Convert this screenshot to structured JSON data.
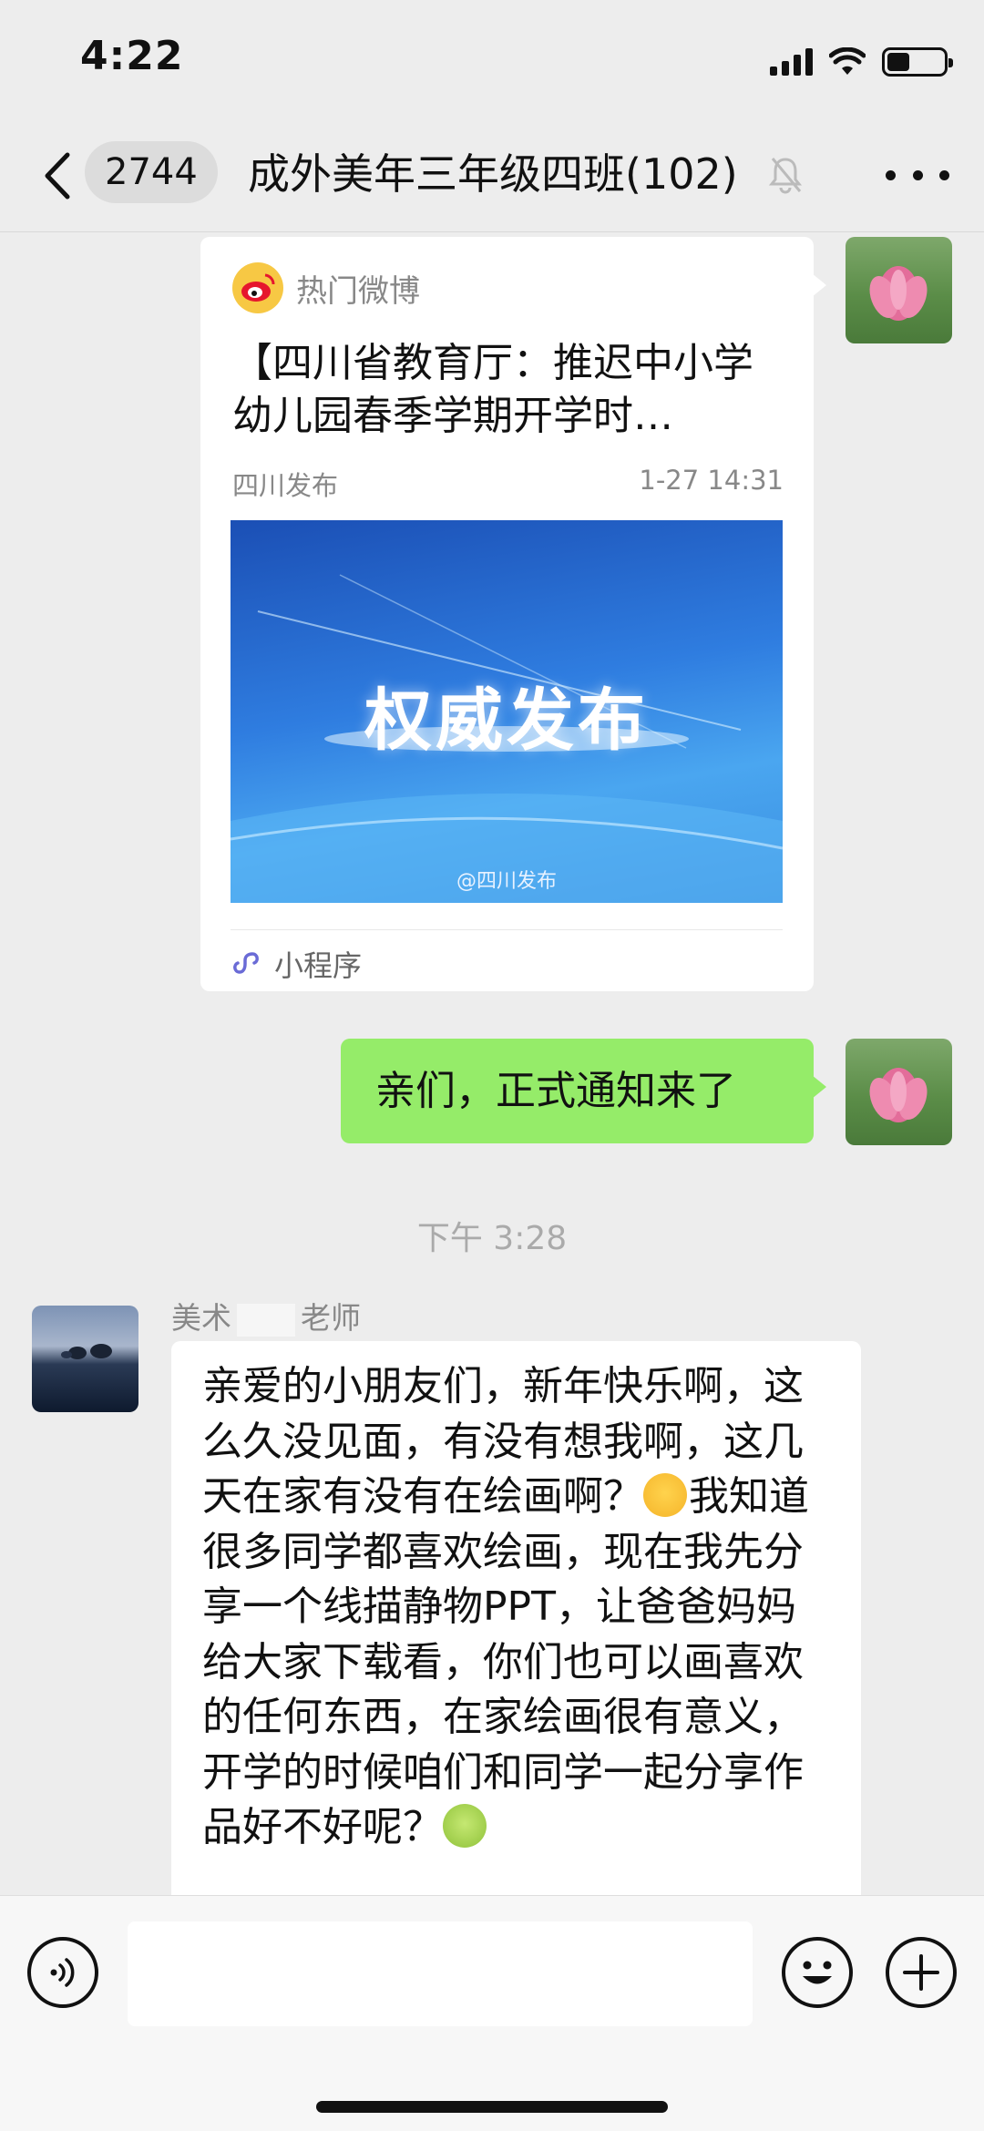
{
  "status_bar": {
    "time": "4:22"
  },
  "nav": {
    "unread_count": "2744",
    "title": "成外美年三年级四班(102)"
  },
  "card": {
    "source": "热门微博",
    "title": "【四川省教育厅：推迟中小学幼儿园春季学期开学时…",
    "publisher": "四川发布",
    "date": "1-27 14:31",
    "image_text": "权威发布",
    "image_watermark": "@四川发布",
    "footer_label": "小程序"
  },
  "messages": {
    "me_text": "亲们，正式通知来了",
    "time_label": "下午 3:28",
    "sender_prefix": "美术",
    "sender_suffix": "老师",
    "body_part1": "亲爱的小朋友们，新年快乐啊，这么久没见面，有没有想我啊，这几天在家有没有在绘画啊？",
    "body_part2": "我知道很多同学都喜欢绘画，现在我先分享一个线描静物PPT，让爸爸妈妈给大家下载看，你们也可以画喜欢的任何东西，在家绘画很有意义，开学的时候咱们和同学一起分享作品好不好呢？"
  },
  "input": {
    "value": ""
  },
  "colors": {
    "bubble_green": "#95ec69",
    "background": "#ededed"
  }
}
